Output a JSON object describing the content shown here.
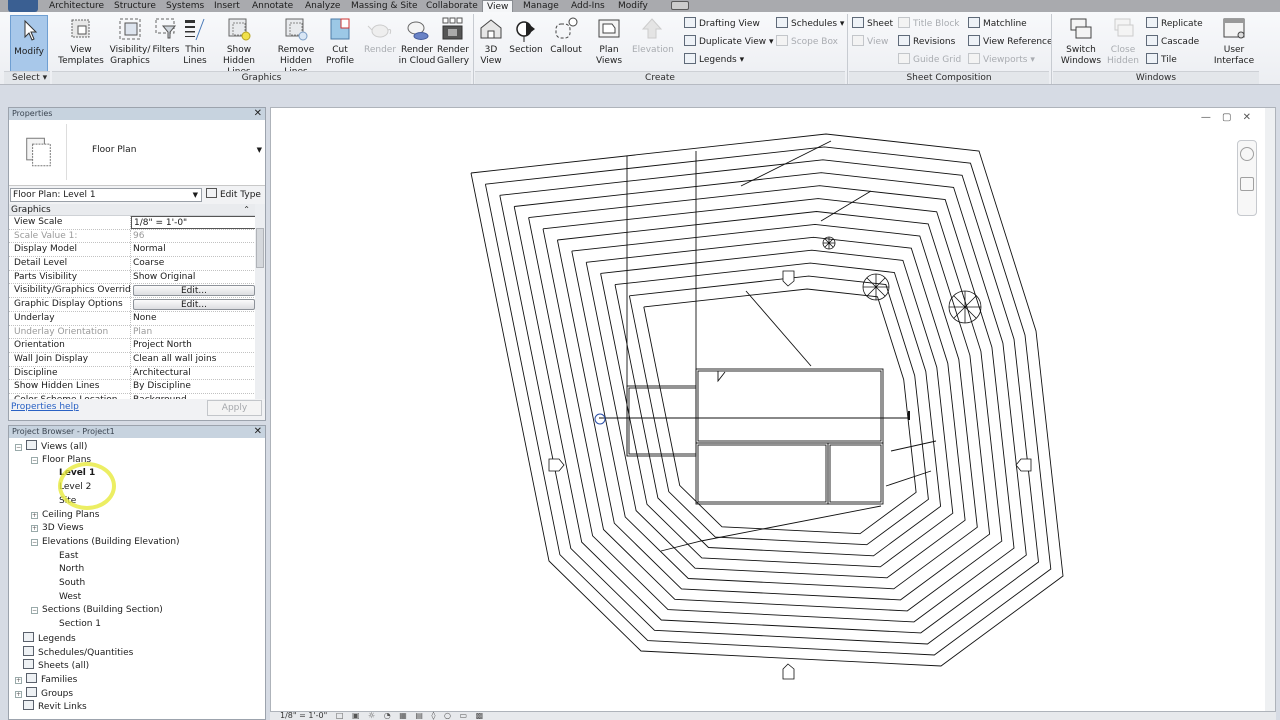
{
  "ribbon_tabs": [
    {
      "label": "Architecture",
      "active": false
    },
    {
      "label": "Structure",
      "active": false
    },
    {
      "label": "Systems",
      "active": false
    },
    {
      "label": "Insert",
      "active": false
    },
    {
      "label": "Annotate",
      "active": false
    },
    {
      "label": "Analyze",
      "active": false
    },
    {
      "label": "Massing & Site",
      "active": false
    },
    {
      "label": "Collaborate",
      "active": false
    },
    {
      "label": "View",
      "active": true
    },
    {
      "label": "Manage",
      "active": false
    },
    {
      "label": "Add-Ins",
      "active": false
    },
    {
      "label": "Modify",
      "active": false
    }
  ],
  "ribbon": {
    "select": {
      "modify": "Modify",
      "panel": "Select ▾"
    },
    "graphics": {
      "panel": "Graphics",
      "view_templates": "View Templates",
      "visibility_graphics": "Visibility/ Graphics",
      "filters": "Filters",
      "thin_lines": "Thin Lines",
      "show_hidden_lines": "Show Hidden Lines",
      "remove_hidden_lines": "Remove Hidden Lines",
      "cut_profile": "Cut Profile",
      "render": "Render",
      "render_in_cloud": "Render in Cloud",
      "render_gallery": "Render Gallery"
    },
    "create": {
      "panel": "Create",
      "view_3d": "3D View",
      "section": "Section",
      "callout": "Callout",
      "plan_views": "Plan Views",
      "elevation": "Elevation",
      "drafting_view": "Drafting View",
      "duplicate_view": "Duplicate View ▾",
      "legends": "Legends ▾",
      "schedules": "Schedules ▾",
      "scope_box": "Scope Box"
    },
    "sheet_composition": {
      "panel": "Sheet Composition",
      "sheet": "Sheet",
      "title_block": "Title Block",
      "matchline": "Matchline",
      "view": "View",
      "revisions": "Revisions",
      "view_reference": "View Reference",
      "guide_grid": "Guide Grid",
      "viewports": "Viewports ▾"
    },
    "windows": {
      "panel": "Windows",
      "switch_windows": "Switch Windows",
      "close_hidden": "Close Hidden",
      "replicate": "Replicate",
      "cascade": "Cascade",
      "tile": "Tile",
      "user_interface": "User Interface"
    }
  },
  "properties": {
    "title": "Properties",
    "type_name": "Floor Plan",
    "instance_selector": "Floor Plan: Level 1",
    "edit_type": "Edit Type",
    "group": "Graphics",
    "rows": [
      {
        "key": "View Scale",
        "value": "1/8\" = 1'-0\"",
        "dim": false,
        "kind": "input"
      },
      {
        "key": "Scale Value    1:",
        "value": "96",
        "dim": true,
        "kind": "text"
      },
      {
        "key": "Display Model",
        "value": "Normal",
        "dim": false,
        "kind": "text"
      },
      {
        "key": "Detail Level",
        "value": "Coarse",
        "dim": false,
        "kind": "text"
      },
      {
        "key": "Parts Visibility",
        "value": "Show Original",
        "dim": false,
        "kind": "text"
      },
      {
        "key": "Visibility/Graphics Overrides",
        "value": "Edit...",
        "dim": false,
        "kind": "button"
      },
      {
        "key": "Graphic Display Options",
        "value": "Edit...",
        "dim": false,
        "kind": "button"
      },
      {
        "key": "Underlay",
        "value": "None",
        "dim": false,
        "kind": "text"
      },
      {
        "key": "Underlay Orientation",
        "value": "Plan",
        "dim": true,
        "kind": "text"
      },
      {
        "key": "Orientation",
        "value": "Project North",
        "dim": false,
        "kind": "text"
      },
      {
        "key": "Wall Join Display",
        "value": "Clean all wall joins",
        "dim": false,
        "kind": "text"
      },
      {
        "key": "Discipline",
        "value": "Architectural",
        "dim": false,
        "kind": "text"
      },
      {
        "key": "Show Hidden Lines",
        "value": "By Discipline",
        "dim": false,
        "kind": "text"
      },
      {
        "key": "Color Scheme Location",
        "value": "Background",
        "dim": false,
        "kind": "text"
      }
    ],
    "help_link": "Properties help",
    "apply": "Apply"
  },
  "project_browser": {
    "title": "Project Browser - Project1",
    "nodes": [
      {
        "label": "Views (all)",
        "toggle": "−",
        "icon": true,
        "bold": false
      },
      {
        "label": "Floor Plans",
        "toggle": "−",
        "icon": false,
        "bold": false
      },
      {
        "label": "Level 1",
        "toggle": "",
        "icon": false,
        "bold": true
      },
      {
        "label": "Level 2",
        "toggle": "",
        "icon": false,
        "bold": false
      },
      {
        "label": "Site",
        "toggle": "",
        "icon": false,
        "bold": false
      },
      {
        "label": "Ceiling Plans",
        "toggle": "+",
        "icon": false,
        "bold": false
      },
      {
        "label": "3D Views",
        "toggle": "+",
        "icon": false,
        "bold": false
      },
      {
        "label": "Elevations (Building Elevation)",
        "toggle": "−",
        "icon": false,
        "bold": false
      },
      {
        "label": "East",
        "toggle": "",
        "icon": false,
        "bold": false
      },
      {
        "label": "North",
        "toggle": "",
        "icon": false,
        "bold": false
      },
      {
        "label": "South",
        "toggle": "",
        "icon": false,
        "bold": false
      },
      {
        "label": "West",
        "toggle": "",
        "icon": false,
        "bold": false
      },
      {
        "label": "Sections (Building Section)",
        "toggle": "−",
        "icon": false,
        "bold": false
      },
      {
        "label": "Section 1",
        "toggle": "",
        "icon": false,
        "bold": false
      },
      {
        "label": "Legends",
        "toggle": "",
        "icon": true,
        "bold": false
      },
      {
        "label": "Schedules/Quantities",
        "toggle": "",
        "icon": true,
        "bold": false
      },
      {
        "label": "Sheets (all)",
        "toggle": "",
        "icon": true,
        "bold": false
      },
      {
        "label": "Families",
        "toggle": "+",
        "icon": true,
        "bold": false
      },
      {
        "label": "Groups",
        "toggle": "+",
        "icon": true,
        "bold": false
      },
      {
        "label": "Revit Links",
        "toggle": "",
        "icon": true,
        "bold": false
      }
    ]
  },
  "view_control_bar": {
    "scale": "1/8\" = 1'-0\""
  },
  "canvas": {
    "window_controls": "— ▢ ✕"
  }
}
